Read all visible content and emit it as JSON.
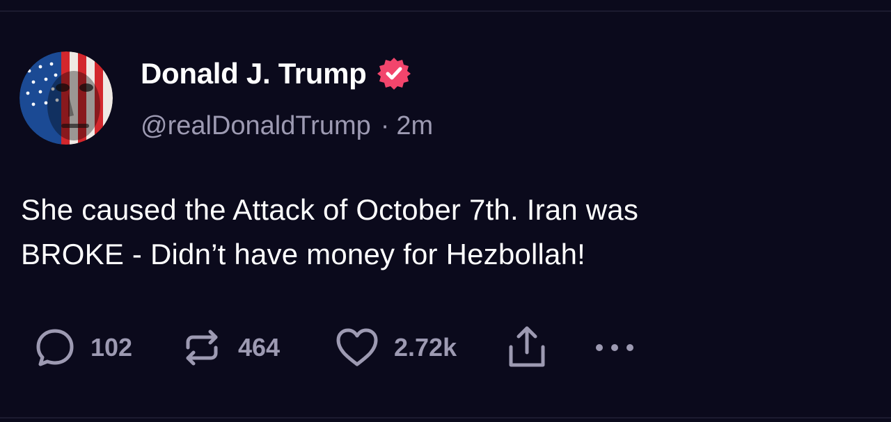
{
  "post": {
    "author": {
      "display_name": "Donald J. Trump",
      "handle": "@realDonaldTrump",
      "verified": true,
      "verified_color": "#f2456c"
    },
    "separator": "·",
    "timestamp": "2m",
    "text_line1": "She caused the Attack of October 7th. Iran was",
    "text_line2": "BROKE - Didn’t have money for Hezbollah!",
    "actions": {
      "replies": "102",
      "reposts": "464",
      "likes": "2.72k"
    }
  },
  "icons": {
    "reply": "speech-bubble-icon",
    "repost": "repost-arrows-icon",
    "like": "heart-icon",
    "share": "share-icon",
    "more": "more-dots-icon",
    "verified": "verified-badge-icon"
  },
  "colors": {
    "background": "#0b0a1c",
    "text_primary": "#ffffff",
    "text_secondary": "#9d9ab2"
  }
}
